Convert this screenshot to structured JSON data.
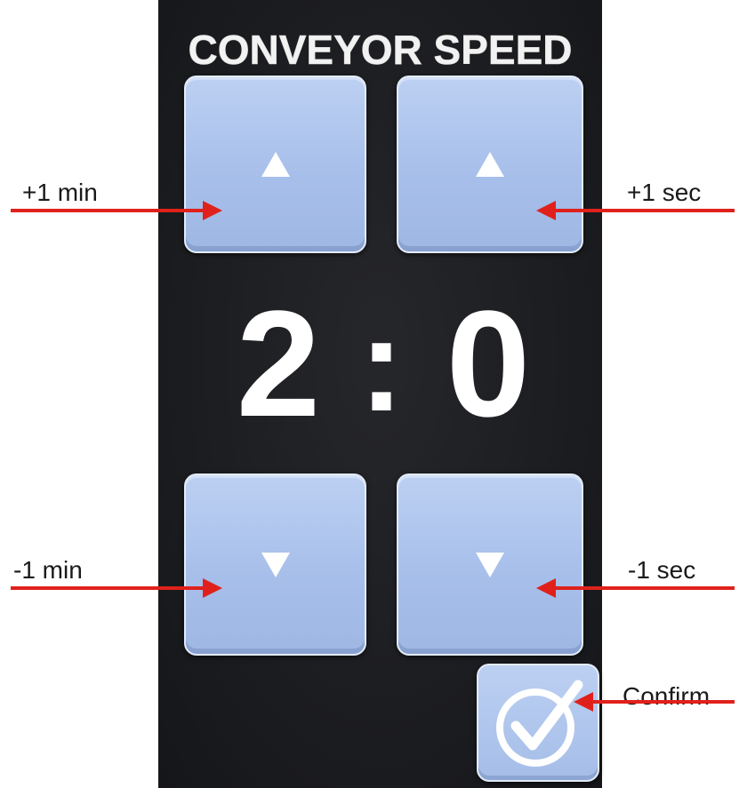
{
  "screen": {
    "title": "CONVEYOR SPEED",
    "time": {
      "minutes": "2",
      "separator": ":",
      "seconds": "0"
    },
    "buttons": {
      "min_up_icon": "triangle-up-icon",
      "sec_up_icon": "triangle-up-icon",
      "min_down_icon": "triangle-down-icon",
      "sec_down_icon": "triangle-down-icon",
      "confirm_icon": "check-circle-icon"
    }
  },
  "annotations": {
    "plus_min": "+1 min",
    "plus_sec": "+1 sec",
    "minus_min": "-1 min",
    "minus_sec": "-1 sec",
    "confirm": "Confirm"
  },
  "colors": {
    "screen_background": "#1c1d21",
    "button_fill": "#a7bfea",
    "button_border": "#e3ebf9",
    "text": "#ffffff",
    "arrow": "#e0211b"
  }
}
